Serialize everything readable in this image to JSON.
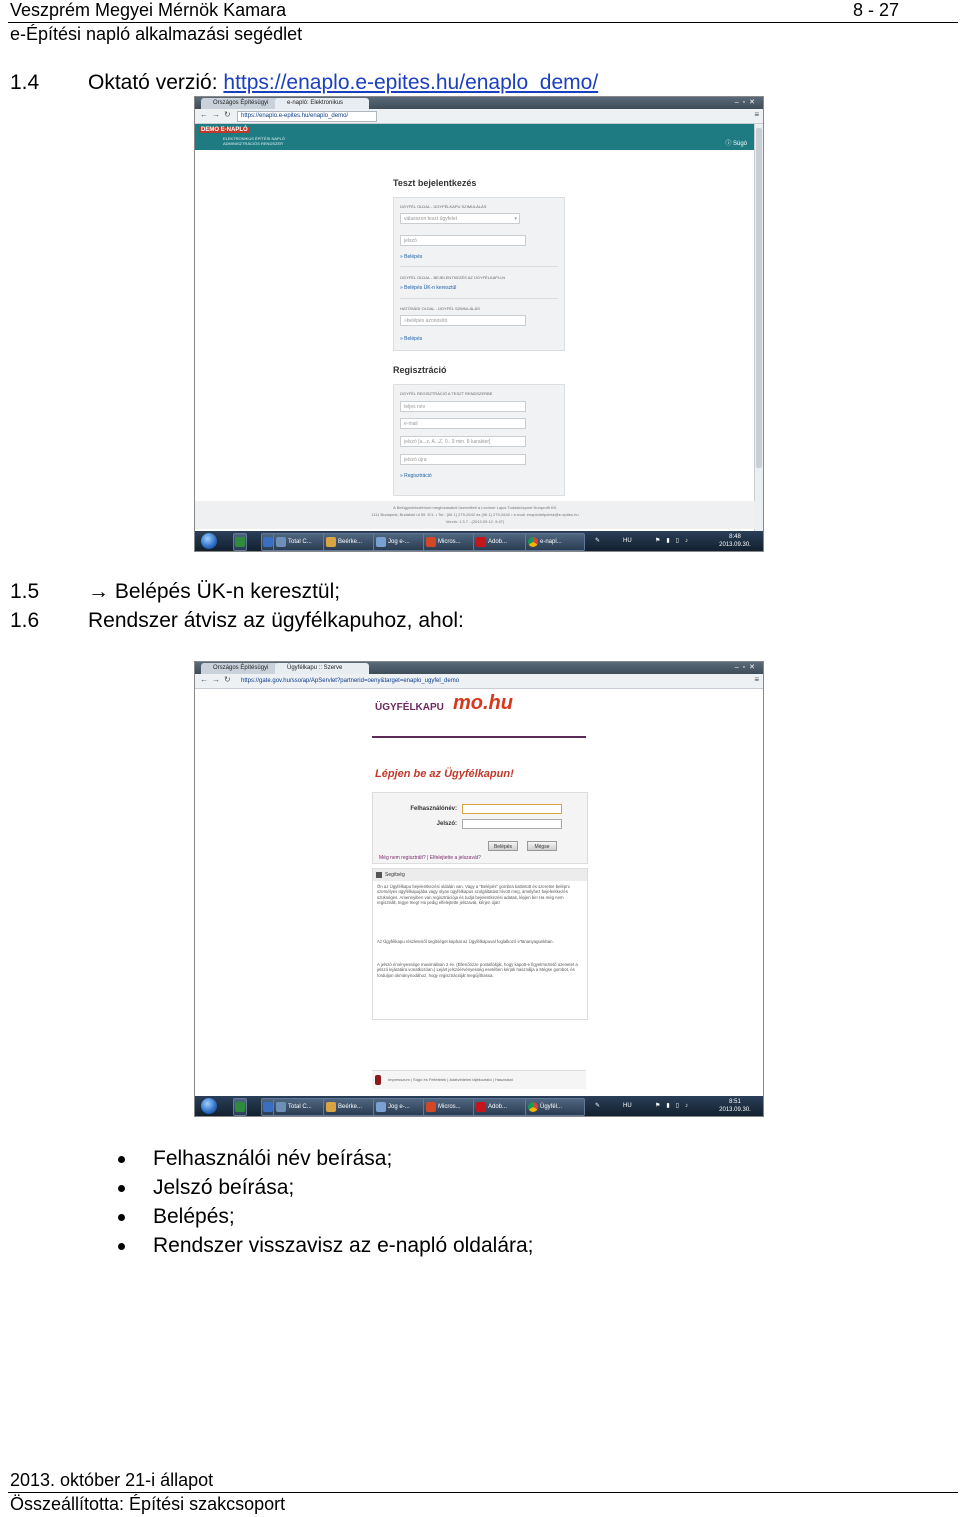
{
  "header": {
    "org": "Veszprém Megyei Mérnök Kamara",
    "subtitle": "e-Építési napló alkalmazási segédlet",
    "page": "8 - 27"
  },
  "section_1_4": {
    "number": "1.4",
    "text": "Oktató verzió:",
    "url": "https://enaplo.e-epites.hu/enaplo_demo/"
  },
  "shot1": {
    "tabs": [
      "Országos Építésügyi",
      "e-napló: Elektronikus"
    ],
    "url": "https://enaplo.e-epites.hu/enaplo_demo/",
    "logo_badge": "DEMO E-NAPLÓ",
    "logo_lines": [
      "ELEKTRONIKUS ÉPÍTÉSI NAPLÓ",
      "ADMINISZTRÁCIÓS RENDSZER"
    ],
    "help_link": "Súgó",
    "login": {
      "title": "Teszt bejelentkezés",
      "sec1_label": "ÜGYFÉL OLDAL - ÜGYFÉLKAPU SZIMULÁLÁS",
      "select_value": "válasszon teszt ügyfelet",
      "password_placeholder": "jelszó",
      "login_link": "» Belépés",
      "sec2_label": "ÜGYFÉL OLDAL - BEJELENTKEZÉS AZ ÜGYFÉLKAPU-N",
      "uk_link": "» Belépés ÜK-n keresztül",
      "sec3_label": "HATÓSÁGI OLDAL - ÜGYFÉL SZIMULÁLÁS",
      "id_placeholder": "»belépés azonosító",
      "login_link2": "» Belépés"
    },
    "register": {
      "title": "Regisztráció",
      "label": "ÜGYFÉL REGISZTRÁCIÓ A TESZT RENDSZERBE",
      "name_placeholder": "teljes név",
      "email_placeholder": "e-mail",
      "pw_placeholder": "jelszó [a...z, A...Z, 0...9 min. 8 karakter]",
      "pw2_placeholder": "jelszó újra",
      "submit_link": "» Regisztráció"
    },
    "footer_lines": [
      "A Belügyminisztérium megbízásából üzemelteti a Lechner Lajos Tudásközpont Nonprofit Kft.",
      "1111 Budapest, Budafoki út 59. E/1. • Tel.: (06 1) 279-2642 és (06 1) 279-2640 • e-mail: enaplohelpdesk@e-epites.hu",
      "Verzió: 1.3.7 - (2013.09.12. 9:47)"
    ],
    "taskbar": {
      "items": [
        "",
        "",
        "Total C...",
        "Beérke...",
        "Jog e-...",
        "Micros...",
        "Adob...",
        "e-napl..."
      ],
      "lang": "HU",
      "time": "8:48",
      "date": "2013.09.30."
    }
  },
  "section_1_5": {
    "number": "1.5",
    "arrow": "→",
    "text": "Belépés ÜK-n keresztül;"
  },
  "section_1_6": {
    "number": "1.6",
    "text": "Rendszer átvisz az ügyfélkapuhoz, ahol:"
  },
  "shot2": {
    "tabs": [
      "Országos Építésügyi",
      "Ügyfélkapu :: Szerve"
    ],
    "url": "https://gate.gov.hu/sso/ap/ApServlet?partnerid=oeny&target=enaplo_ugyfel_demo",
    "logo": "ÜGYFÉLKAPU",
    "logo_mo": "mo.hu",
    "title": "Lépjen be az Ügyfélkapun!",
    "username_label": "Felhasználónév:",
    "password_label": "Jelszó:",
    "login_btn": "Belépés",
    "cancel_btn": "Mégse",
    "links": "Még nem regisztrált? | Elfelejtette a jelszavát?",
    "help_title": "Segítség",
    "help_paragraphs": [
      "Ön az Ügyfélkapu bejelentkezési oldalán van. Vagy a \"Belépés\" gombra kattintott és szeretne belépni személyes ügyfélkapujába vagy olyan ügyfélkapus szolgáltatást hívott meg, amelyhez bejelentkezés szükséges. Amennyiben van regisztrációja és tudja bejelentkezési adatait, lépjen be! Ha még nem regisztrált, tegye meg! Ha pedig elfelejtette jelszavát, kérjen újat!",
      "Az Ügyfélkapu részleteiről segítséget kaphat az Ügyfélkapuval foglalkozó eTananyagunkban.",
      "A jelszó érvényessége maximálisan 2 év. (Ellenőrizze postafiókját, hogy kapott-e figyelmeztető üzenetet a jelszó lejáratára vonatkozóan.) Lejárt jelszóérvényesség esetében kérjük használja a Mégse gombot, és forduljon okmányirodához, hogy regisztrációját megújíthassa."
    ],
    "footer": "Impresszum | Súgó és Feltételek | Adatvédelmi tájékoztató | Használat",
    "taskbar": {
      "items": [
        "",
        "",
        "Total C...",
        "Beérke...",
        "Jog e-...",
        "Micros...",
        "Adob...",
        "Ügyfél..."
      ],
      "lang": "HU",
      "time": "8:51",
      "date": "2013.09.30."
    }
  },
  "bullets": [
    "Felhasználói név beírása;",
    "Jelszó beírása;",
    "Belépés;",
    "Rendszer visszavisz az e-napló oldalára;"
  ],
  "footer": {
    "state": "2013. október 21-i állapot",
    "author": "Összeállította: Építési szakcsoport"
  }
}
